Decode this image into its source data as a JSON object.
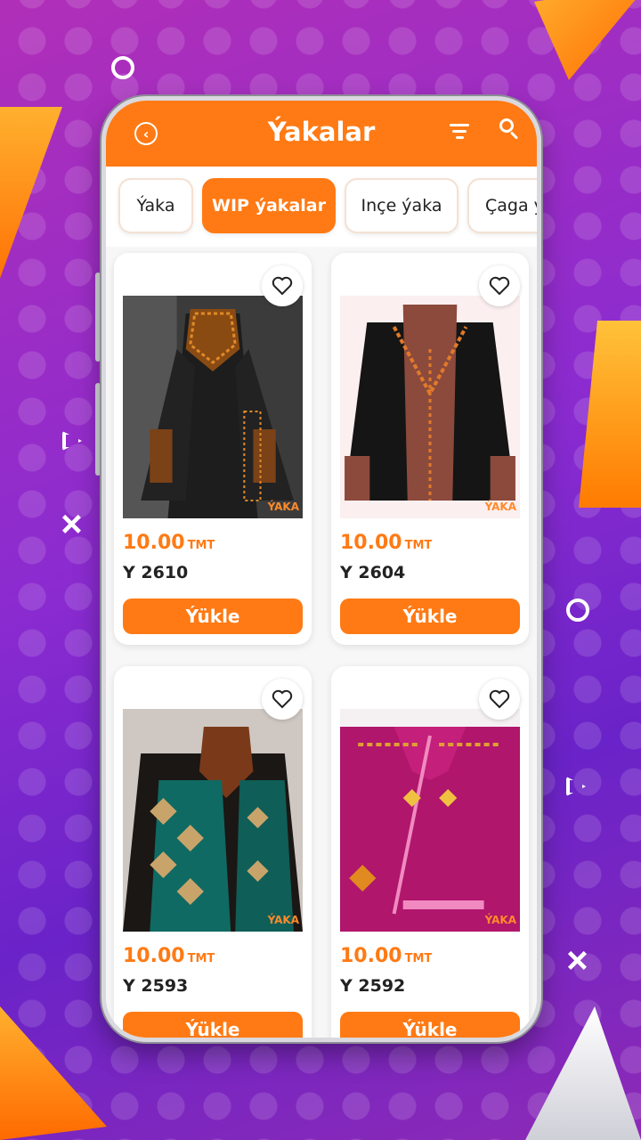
{
  "app": {
    "title": "Ýakalar"
  },
  "header": {
    "back_icon": "chevron-left-icon",
    "filter_icon": "filter-icon",
    "search_icon": "search-icon"
  },
  "categories": [
    {
      "label": "Ýaka",
      "active": false
    },
    {
      "label": "WIP ýakalar",
      "active": true
    },
    {
      "label": "Inçe ýaka",
      "active": false
    },
    {
      "label": "Çaga ýaka",
      "active": false
    }
  ],
  "products": [
    {
      "price": "10.00",
      "currency": "TMT",
      "code": "Y 2610",
      "button": "Ýükle",
      "watermark": "ÝAKA"
    },
    {
      "price": "10.00",
      "currency": "TMT",
      "code": "Y 2604",
      "button": "Ýükle",
      "watermark": "ÝAKA"
    },
    {
      "price": "10.00",
      "currency": "TMT",
      "code": "Y 2593",
      "button": "Ýükle",
      "watermark": "ÝAKA"
    },
    {
      "price": "10.00",
      "currency": "TMT",
      "code": "Y 2592",
      "button": "Ýükle",
      "watermark": "ÝAKA"
    }
  ],
  "colors": {
    "accent": "#ff7a14",
    "background_gradient": [
      "#b02fb8",
      "#6a23c8"
    ]
  }
}
